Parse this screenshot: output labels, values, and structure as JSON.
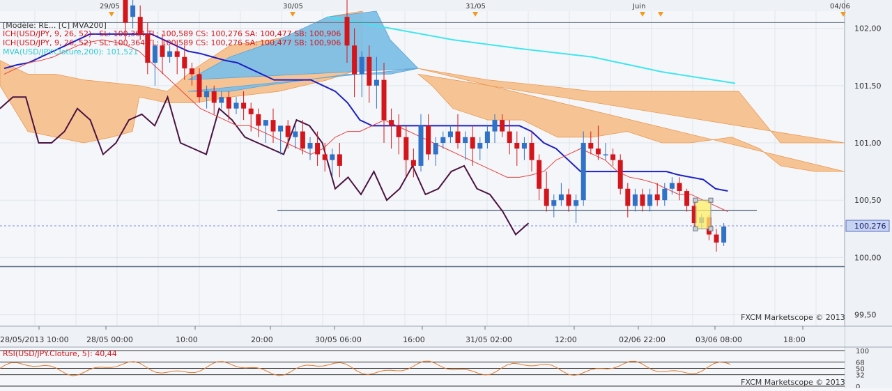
{
  "colors": {
    "background": "#f4f6f9",
    "grid": "#dfe5ec",
    "bull": "#2f72c8",
    "bear": "#d4151c",
    "kijun": "#1c1fc4",
    "tenkan": "#e64040",
    "chikou": "#4a1240",
    "mva": "#3fe6ef",
    "cloud_bear": "#f6c18e",
    "cloud_bull": "#7ebfe6",
    "rsi": "#e07a2c",
    "price_tag": "#c6d3f1"
  },
  "top_dates": [
    "29/05",
    "30/05",
    "31/05",
    "Juin",
    "04/06"
  ],
  "legend": {
    "line0": "[Modèle: RE... [C] MVA200]",
    "line1": "ICH(USD/JPY, 9, 26, 52) -   SL: 100,364   TL: 100,589   CS: 100,276   SA: 100,477   SB: 100,906",
    "line2": "ICH(USD/JPY, 9, 26, 52) -   SL: 100,364   TL: 100,589   CS: 100,276   SA: 100,477   SB: 100,906",
    "line3": "MVA(USD/JPY.Cloture,200): 101,521"
  },
  "price_labels": [
    "102,00",
    "101,50",
    "101,00",
    "100,50",
    "100,00",
    "99,50"
  ],
  "current_price": "100,276",
  "watermark": "FXCM Marketscope © 2013",
  "time_labels": [
    "28/05/2013 10:00",
    "28/05 00:00",
    "10:00",
    "20:00",
    "30/05 06:00",
    "16:00",
    "31/05 02:00",
    "12:00",
    "02/06 22:00",
    "03/06 08:00",
    "18:00"
  ],
  "rsi_legend": "RSI(USD/JPY.Cloture, 5): 40,44",
  "rsi_labels": [
    "100",
    "68",
    "50",
    "32",
    "0"
  ],
  "rsi_watermark": "FXCM Marketscope © 2013",
  "chart_data": {
    "type": "candlestick",
    "symbol": "USD/JPY",
    "ylim": [
      99.4,
      102.15
    ],
    "candles": [
      {
        "o": 102.4,
        "h": 102.6,
        "c": 102.05,
        "l": 101.9
      },
      {
        "o": 102.1,
        "h": 102.3,
        "c": 102.2,
        "l": 102.0
      },
      {
        "o": 102.1,
        "h": 102.2,
        "c": 101.95,
        "l": 101.9
      },
      {
        "o": 101.95,
        "h": 102.05,
        "c": 101.7,
        "l": 101.6
      },
      {
        "o": 101.7,
        "h": 101.8,
        "c": 101.85,
        "l": 101.5
      },
      {
        "o": 101.85,
        "h": 101.95,
        "c": 101.75,
        "l": 101.6
      },
      {
        "o": 101.75,
        "h": 101.85,
        "c": 101.8,
        "l": 101.7
      },
      {
        "o": 101.8,
        "h": 101.9,
        "c": 101.75,
        "l": 101.6
      },
      {
        "o": 101.75,
        "h": 101.85,
        "c": 101.65,
        "l": 101.55
      },
      {
        "o": 101.65,
        "h": 101.7,
        "c": 101.6,
        "l": 101.5
      },
      {
        "o": 101.6,
        "h": 101.65,
        "c": 101.4,
        "l": 101.35
      },
      {
        "o": 101.4,
        "h": 101.5,
        "c": 101.45,
        "l": 101.3
      },
      {
        "o": 101.45,
        "h": 101.5,
        "c": 101.35,
        "l": 101.25
      },
      {
        "o": 101.35,
        "h": 101.45,
        "c": 101.4,
        "l": 101.3
      },
      {
        "o": 101.4,
        "h": 101.45,
        "c": 101.3,
        "l": 101.2
      },
      {
        "o": 101.3,
        "h": 101.4,
        "c": 101.35,
        "l": 101.25
      },
      {
        "o": 101.35,
        "h": 101.45,
        "c": 101.3,
        "l": 101.2
      },
      {
        "o": 101.3,
        "h": 101.35,
        "c": 101.25,
        "l": 101.1
      },
      {
        "o": 101.25,
        "h": 101.3,
        "c": 101.15,
        "l": 101.05
      },
      {
        "o": 101.15,
        "h": 101.2,
        "c": 101.2,
        "l": 101.0
      },
      {
        "o": 101.2,
        "h": 101.3,
        "c": 101.1,
        "l": 101.0
      },
      {
        "o": 101.1,
        "h": 101.15,
        "c": 101.15,
        "l": 100.9
      },
      {
        "o": 101.15,
        "h": 101.2,
        "c": 101.05,
        "l": 100.95
      },
      {
        "o": 101.05,
        "h": 101.15,
        "c": 101.1,
        "l": 100.95
      },
      {
        "o": 101.1,
        "h": 101.2,
        "c": 100.95,
        "l": 100.9
      },
      {
        "o": 100.95,
        "h": 101.05,
        "c": 101.0,
        "l": 100.85
      },
      {
        "o": 101.0,
        "h": 101.1,
        "c": 100.9,
        "l": 100.8
      },
      {
        "o": 100.9,
        "h": 101.0,
        "c": 100.85,
        "l": 100.75
      },
      {
        "o": 100.85,
        "h": 100.95,
        "c": 100.9,
        "l": 100.7
      },
      {
        "o": 100.9,
        "h": 101.0,
        "c": 100.8,
        "l": 100.7
      },
      {
        "o": 102.1,
        "h": 102.3,
        "c": 101.85,
        "l": 101.7
      },
      {
        "o": 101.85,
        "h": 102.0,
        "c": 101.6,
        "l": 101.4
      },
      {
        "o": 101.6,
        "h": 101.8,
        "c": 101.75,
        "l": 101.4
      },
      {
        "o": 101.75,
        "h": 101.85,
        "c": 101.5,
        "l": 101.35
      },
      {
        "o": 101.5,
        "h": 101.75,
        "c": 101.55,
        "l": 101.3
      },
      {
        "o": 101.55,
        "h": 101.7,
        "c": 101.2,
        "l": 101.0
      },
      {
        "o": 101.2,
        "h": 101.3,
        "c": 101.15,
        "l": 100.95
      },
      {
        "o": 101.15,
        "h": 101.25,
        "c": 101.05,
        "l": 100.9
      },
      {
        "o": 101.05,
        "h": 101.15,
        "c": 100.85,
        "l": 100.7
      },
      {
        "o": 100.85,
        "h": 100.95,
        "c": 100.8,
        "l": 100.7
      },
      {
        "o": 100.8,
        "h": 101.25,
        "c": 101.15,
        "l": 100.75
      },
      {
        "o": 101.15,
        "h": 101.25,
        "c": 100.9,
        "l": 100.85
      },
      {
        "o": 100.9,
        "h": 101.05,
        "c": 101.0,
        "l": 100.8
      },
      {
        "o": 101.0,
        "h": 101.1,
        "c": 101.05,
        "l": 100.95
      },
      {
        "o": 101.05,
        "h": 101.15,
        "c": 101.1,
        "l": 101.0
      },
      {
        "o": 101.1,
        "h": 101.25,
        "c": 101.0,
        "l": 100.95
      },
      {
        "o": 101.0,
        "h": 101.1,
        "c": 101.05,
        "l": 100.85
      },
      {
        "o": 101.05,
        "h": 101.15,
        "c": 100.95,
        "l": 100.8
      },
      {
        "o": 100.95,
        "h": 101.05,
        "c": 101.0,
        "l": 100.85
      },
      {
        "o": 101.0,
        "h": 101.15,
        "c": 101.1,
        "l": 100.95
      },
      {
        "o": 101.1,
        "h": 101.25,
        "c": 101.2,
        "l": 101.0
      },
      {
        "o": 101.2,
        "h": 101.25,
        "c": 101.1,
        "l": 101.05
      },
      {
        "o": 101.1,
        "h": 101.2,
        "c": 101.0,
        "l": 100.9
      },
      {
        "o": 101.0,
        "h": 101.1,
        "c": 100.95,
        "l": 100.8
      },
      {
        "o": 100.95,
        "h": 101.05,
        "c": 101.0,
        "l": 100.85
      },
      {
        "o": 101.0,
        "h": 101.1,
        "c": 100.85,
        "l": 100.75
      },
      {
        "o": 100.85,
        "h": 100.9,
        "c": 100.6,
        "l": 100.5
      },
      {
        "o": 100.6,
        "h": 100.75,
        "c": 100.45,
        "l": 100.4
      },
      {
        "o": 100.45,
        "h": 100.55,
        "c": 100.5,
        "l": 100.35
      },
      {
        "o": 100.5,
        "h": 100.65,
        "c": 100.55,
        "l": 100.45
      },
      {
        "o": 100.55,
        "h": 100.6,
        "c": 100.45,
        "l": 100.4
      },
      {
        "o": 100.45,
        "h": 100.55,
        "c": 100.5,
        "l": 100.3
      },
      {
        "o": 100.5,
        "h": 101.1,
        "c": 101.0,
        "l": 100.45
      },
      {
        "o": 101.0,
        "h": 101.1,
        "c": 100.95,
        "l": 100.9
      },
      {
        "o": 100.95,
        "h": 101.15,
        "c": 100.9,
        "l": 100.85
      },
      {
        "o": 100.9,
        "h": 101.0,
        "c": 100.9,
        "l": 100.85
      },
      {
        "o": 100.9,
        "h": 100.95,
        "c": 100.85,
        "l": 100.8
      },
      {
        "o": 100.85,
        "h": 100.9,
        "c": 100.6,
        "l": 100.55
      },
      {
        "o": 100.6,
        "h": 100.65,
        "c": 100.45,
        "l": 100.35
      },
      {
        "o": 100.45,
        "h": 100.6,
        "c": 100.55,
        "l": 100.4
      },
      {
        "o": 100.55,
        "h": 100.6,
        "c": 100.45,
        "l": 100.4
      },
      {
        "o": 100.45,
        "h": 100.6,
        "c": 100.55,
        "l": 100.4
      },
      {
        "o": 100.55,
        "h": 100.65,
        "c": 100.5,
        "l": 100.45
      },
      {
        "o": 100.5,
        "h": 100.65,
        "c": 100.6,
        "l": 100.45
      },
      {
        "o": 100.6,
        "h": 100.7,
        "c": 100.65,
        "l": 100.55
      },
      {
        "o": 100.65,
        "h": 100.7,
        "c": 100.58,
        "l": 100.5
      },
      {
        "o": 100.58,
        "h": 100.6,
        "c": 100.45,
        "l": 100.4
      },
      {
        "o": 100.45,
        "h": 100.5,
        "c": 100.3,
        "l": 100.25
      },
      {
        "o": 100.3,
        "h": 100.38,
        "c": 100.35,
        "l": 100.25
      },
      {
        "o": 100.35,
        "h": 100.37,
        "c": 100.2,
        "l": 100.15
      },
      {
        "o": 100.2,
        "h": 100.25,
        "c": 100.13,
        "l": 100.05
      },
      {
        "o": 100.13,
        "h": 100.3,
        "c": 100.27,
        "l": 100.1
      }
    ],
    "kijun_sen": [
      101.65,
      101.68,
      101.7,
      101.75,
      101.8,
      101.85,
      101.9,
      101.95,
      101.95,
      101.95,
      101.95,
      101.95,
      101.95,
      101.9,
      101.85,
      101.8,
      101.78,
      101.75,
      101.72,
      101.7,
      101.65,
      101.6,
      101.55,
      101.55,
      101.55,
      101.55,
      101.5,
      101.45,
      101.35,
      101.2,
      101.15,
      101.15,
      101.15,
      101.15,
      101.15,
      101.15,
      101.15,
      101.15,
      101.15,
      101.15,
      101.15,
      101.15,
      101.15,
      101.1,
      101.0,
      100.95,
      100.85,
      100.75,
      100.75,
      100.75,
      100.75,
      100.75,
      100.75,
      100.75,
      100.75,
      100.72,
      100.7,
      100.68,
      100.6,
      100.58
    ],
    "tenkan_sen": [
      101.6,
      101.65,
      101.7,
      101.72,
      101.75,
      101.8,
      101.85,
      101.88,
      101.9,
      101.88,
      101.85,
      101.8,
      101.7,
      101.6,
      101.5,
      101.4,
      101.3,
      101.25,
      101.2,
      101.15,
      101.15,
      101.1,
      101.05,
      101.0,
      100.95,
      100.9,
      100.95,
      101.05,
      101.1,
      101.1,
      101.15,
      101.2,
      101.15,
      101.1,
      101.05,
      101.0,
      100.95,
      100.9,
      100.85,
      100.8,
      100.75,
      100.7,
      100.7,
      100.72,
      100.75,
      100.85,
      100.9,
      100.95,
      100.9,
      100.85,
      100.75,
      100.7,
      100.68,
      100.65,
      100.6,
      100.55,
      100.55,
      100.5,
      100.45,
      100.4
    ],
    "chikou_span": [
      101.3,
      101.4,
      101.4,
      101.0,
      101.0,
      101.1,
      101.3,
      101.2,
      100.9,
      101.0,
      101.2,
      101.25,
      101.15,
      101.4,
      101.0,
      100.95,
      100.9,
      101.3,
      101.2,
      101.05,
      101.0,
      100.95,
      100.9,
      101.2,
      101.15,
      101.0,
      100.6,
      100.7,
      100.55,
      100.75,
      100.5,
      100.6,
      100.8,
      100.55,
      100.6,
      100.75,
      100.8,
      100.6,
      100.55,
      100.4,
      100.2,
      100.3
    ]
  }
}
